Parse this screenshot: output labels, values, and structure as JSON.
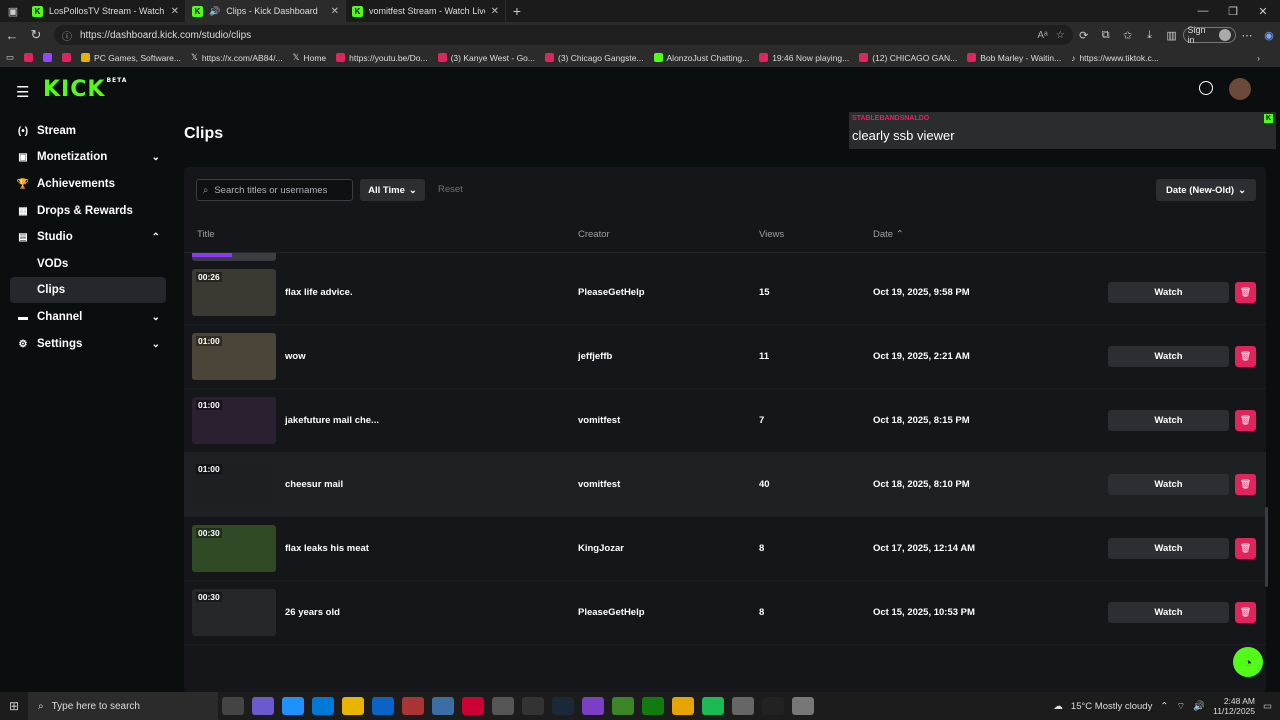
{
  "browser": {
    "tabs": [
      {
        "title": "LosPollosTV Stream - Watch Live o",
        "active": false
      },
      {
        "title": "Clips - Kick Dashboard",
        "active": true
      },
      {
        "title": "vomitfest Stream - Watch Live on",
        "active": false
      }
    ],
    "url": "https://dashboard.kick.com/studio/clips",
    "signin_label": "Sign in",
    "bookmarks": [
      "PC Games, Software...",
      "https://x.com/AB84/...",
      "Home",
      "https://youtu.be/Do...",
      "(3) Kanye West - Go...",
      "(3) Chicago Gangste...",
      "AlonzoJust Chatting...",
      "19:46 Now playing...",
      "(12) CHICAGO GAN...",
      "Bob Marley - Waitin...",
      "https://www.tiktok.c..."
    ]
  },
  "header": {
    "logo": "KICK",
    "logo_badge": "BETA"
  },
  "sidebar": {
    "items": [
      {
        "label": "Stream"
      },
      {
        "label": "Monetization"
      },
      {
        "label": "Achievements"
      },
      {
        "label": "Drops & Rewards"
      },
      {
        "label": "Studio"
      },
      {
        "label": "VODs"
      },
      {
        "label": "Clips"
      },
      {
        "label": "Channel"
      },
      {
        "label": "Settings"
      }
    ]
  },
  "page": {
    "title": "Clips"
  },
  "chat_overlay": {
    "username": "STABLEBANDSNALDO",
    "message": "clearly ssb viewer"
  },
  "filters": {
    "search_placeholder": "Search titles or usernames",
    "time_filter": "All Time",
    "reset_label": "Reset",
    "sort_label": "Date (New-Old)"
  },
  "table": {
    "columns": {
      "title": "Title",
      "creator": "Creator",
      "views": "Views",
      "date": "Date"
    },
    "watch_label": "Watch",
    "rows": [
      {
        "duration": "00:26",
        "title": "flax life advice.",
        "creator": "PleaseGetHelp",
        "views": "15",
        "date": "Oct 19, 2025, 9:58 PM"
      },
      {
        "duration": "01:00",
        "title": "wow",
        "creator": "jeffjeffb",
        "views": "11",
        "date": "Oct 19, 2025, 2:21 AM"
      },
      {
        "duration": "01:00",
        "title": "jakefuture mail che...",
        "creator": "vomitfest",
        "views": "7",
        "date": "Oct 18, 2025, 8:15 PM"
      },
      {
        "duration": "01:00",
        "title": "cheesur mail",
        "creator": "vomitfest",
        "views": "40",
        "date": "Oct 18, 2025, 8:10 PM"
      },
      {
        "duration": "00:30",
        "title": "flax leaks his meat",
        "creator": "KingJozar",
        "views": "8",
        "date": "Oct 17, 2025, 12:14 AM"
      },
      {
        "duration": "00:30",
        "title": "26 years old",
        "creator": "PleaseGetHelp",
        "views": "8",
        "date": "Oct 15, 2025, 10:53 PM"
      }
    ]
  },
  "taskbar": {
    "search_placeholder": "Type here to search",
    "weather": "15°C  Mostly cloudy",
    "time": "2:48 AM",
    "date": "11/12/2025"
  },
  "colors": {
    "accent": "#53fc18",
    "danger": "#e0245e",
    "background": "#0b0e0f",
    "panel": "#141619"
  }
}
